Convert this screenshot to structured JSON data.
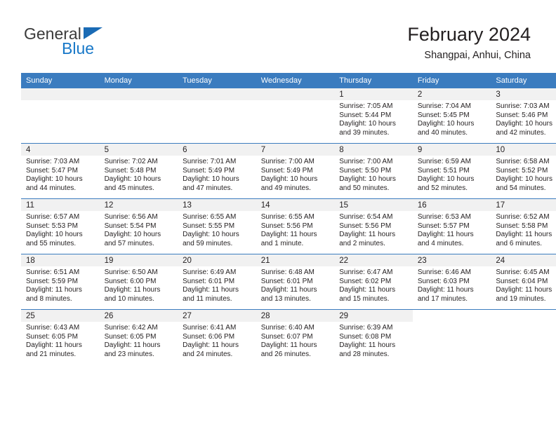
{
  "logo": {
    "word_top": "General",
    "word_bottom": "Blue",
    "triangle_color": "#1a6bb5",
    "blue_color": "#1878c8"
  },
  "header": {
    "title": "February 2024",
    "location": "Shangpai, Anhui, China"
  },
  "theme": {
    "header_blue": "#3b7cbf",
    "daynum_band": "#f1f1f1",
    "text": "#231f20"
  },
  "weekday_headers": [
    "Sunday",
    "Monday",
    "Tuesday",
    "Wednesday",
    "Thursday",
    "Friday",
    "Saturday"
  ],
  "weeks": [
    [
      {
        "day": "",
        "lines": []
      },
      {
        "day": "",
        "lines": []
      },
      {
        "day": "",
        "lines": []
      },
      {
        "day": "",
        "lines": []
      },
      {
        "day": "1",
        "lines": [
          "Sunrise: 7:05 AM",
          "Sunset: 5:44 PM",
          "Daylight: 10 hours",
          "and 39 minutes."
        ]
      },
      {
        "day": "2",
        "lines": [
          "Sunrise: 7:04 AM",
          "Sunset: 5:45 PM",
          "Daylight: 10 hours",
          "and 40 minutes."
        ]
      },
      {
        "day": "3",
        "lines": [
          "Sunrise: 7:03 AM",
          "Sunset: 5:46 PM",
          "Daylight: 10 hours",
          "and 42 minutes."
        ]
      }
    ],
    [
      {
        "day": "4",
        "lines": [
          "Sunrise: 7:03 AM",
          "Sunset: 5:47 PM",
          "Daylight: 10 hours",
          "and 44 minutes."
        ]
      },
      {
        "day": "5",
        "lines": [
          "Sunrise: 7:02 AM",
          "Sunset: 5:48 PM",
          "Daylight: 10 hours",
          "and 45 minutes."
        ]
      },
      {
        "day": "6",
        "lines": [
          "Sunrise: 7:01 AM",
          "Sunset: 5:49 PM",
          "Daylight: 10 hours",
          "and 47 minutes."
        ]
      },
      {
        "day": "7",
        "lines": [
          "Sunrise: 7:00 AM",
          "Sunset: 5:49 PM",
          "Daylight: 10 hours",
          "and 49 minutes."
        ]
      },
      {
        "day": "8",
        "lines": [
          "Sunrise: 7:00 AM",
          "Sunset: 5:50 PM",
          "Daylight: 10 hours",
          "and 50 minutes."
        ]
      },
      {
        "day": "9",
        "lines": [
          "Sunrise: 6:59 AM",
          "Sunset: 5:51 PM",
          "Daylight: 10 hours",
          "and 52 minutes."
        ]
      },
      {
        "day": "10",
        "lines": [
          "Sunrise: 6:58 AM",
          "Sunset: 5:52 PM",
          "Daylight: 10 hours",
          "and 54 minutes."
        ]
      }
    ],
    [
      {
        "day": "11",
        "lines": [
          "Sunrise: 6:57 AM",
          "Sunset: 5:53 PM",
          "Daylight: 10 hours",
          "and 55 minutes."
        ]
      },
      {
        "day": "12",
        "lines": [
          "Sunrise: 6:56 AM",
          "Sunset: 5:54 PM",
          "Daylight: 10 hours",
          "and 57 minutes."
        ]
      },
      {
        "day": "13",
        "lines": [
          "Sunrise: 6:55 AM",
          "Sunset: 5:55 PM",
          "Daylight: 10 hours",
          "and 59 minutes."
        ]
      },
      {
        "day": "14",
        "lines": [
          "Sunrise: 6:55 AM",
          "Sunset: 5:56 PM",
          "Daylight: 11 hours",
          "and 1 minute."
        ]
      },
      {
        "day": "15",
        "lines": [
          "Sunrise: 6:54 AM",
          "Sunset: 5:56 PM",
          "Daylight: 11 hours",
          "and 2 minutes."
        ]
      },
      {
        "day": "16",
        "lines": [
          "Sunrise: 6:53 AM",
          "Sunset: 5:57 PM",
          "Daylight: 11 hours",
          "and 4 minutes."
        ]
      },
      {
        "day": "17",
        "lines": [
          "Sunrise: 6:52 AM",
          "Sunset: 5:58 PM",
          "Daylight: 11 hours",
          "and 6 minutes."
        ]
      }
    ],
    [
      {
        "day": "18",
        "lines": [
          "Sunrise: 6:51 AM",
          "Sunset: 5:59 PM",
          "Daylight: 11 hours",
          "and 8 minutes."
        ]
      },
      {
        "day": "19",
        "lines": [
          "Sunrise: 6:50 AM",
          "Sunset: 6:00 PM",
          "Daylight: 11 hours",
          "and 10 minutes."
        ]
      },
      {
        "day": "20",
        "lines": [
          "Sunrise: 6:49 AM",
          "Sunset: 6:01 PM",
          "Daylight: 11 hours",
          "and 11 minutes."
        ]
      },
      {
        "day": "21",
        "lines": [
          "Sunrise: 6:48 AM",
          "Sunset: 6:01 PM",
          "Daylight: 11 hours",
          "and 13 minutes."
        ]
      },
      {
        "day": "22",
        "lines": [
          "Sunrise: 6:47 AM",
          "Sunset: 6:02 PM",
          "Daylight: 11 hours",
          "and 15 minutes."
        ]
      },
      {
        "day": "23",
        "lines": [
          "Sunrise: 6:46 AM",
          "Sunset: 6:03 PM",
          "Daylight: 11 hours",
          "and 17 minutes."
        ]
      },
      {
        "day": "24",
        "lines": [
          "Sunrise: 6:45 AM",
          "Sunset: 6:04 PM",
          "Daylight: 11 hours",
          "and 19 minutes."
        ]
      }
    ],
    [
      {
        "day": "25",
        "lines": [
          "Sunrise: 6:43 AM",
          "Sunset: 6:05 PM",
          "Daylight: 11 hours",
          "and 21 minutes."
        ]
      },
      {
        "day": "26",
        "lines": [
          "Sunrise: 6:42 AM",
          "Sunset: 6:05 PM",
          "Daylight: 11 hours",
          "and 23 minutes."
        ]
      },
      {
        "day": "27",
        "lines": [
          "Sunrise: 6:41 AM",
          "Sunset: 6:06 PM",
          "Daylight: 11 hours",
          "and 24 minutes."
        ]
      },
      {
        "day": "28",
        "lines": [
          "Sunrise: 6:40 AM",
          "Sunset: 6:07 PM",
          "Daylight: 11 hours",
          "and 26 minutes."
        ]
      },
      {
        "day": "29",
        "lines": [
          "Sunrise: 6:39 AM",
          "Sunset: 6:08 PM",
          "Daylight: 11 hours",
          "and 28 minutes."
        ]
      },
      {
        "day": "",
        "lines": [],
        "no_band": true
      },
      {
        "day": "",
        "lines": [],
        "no_band": true
      }
    ]
  ]
}
